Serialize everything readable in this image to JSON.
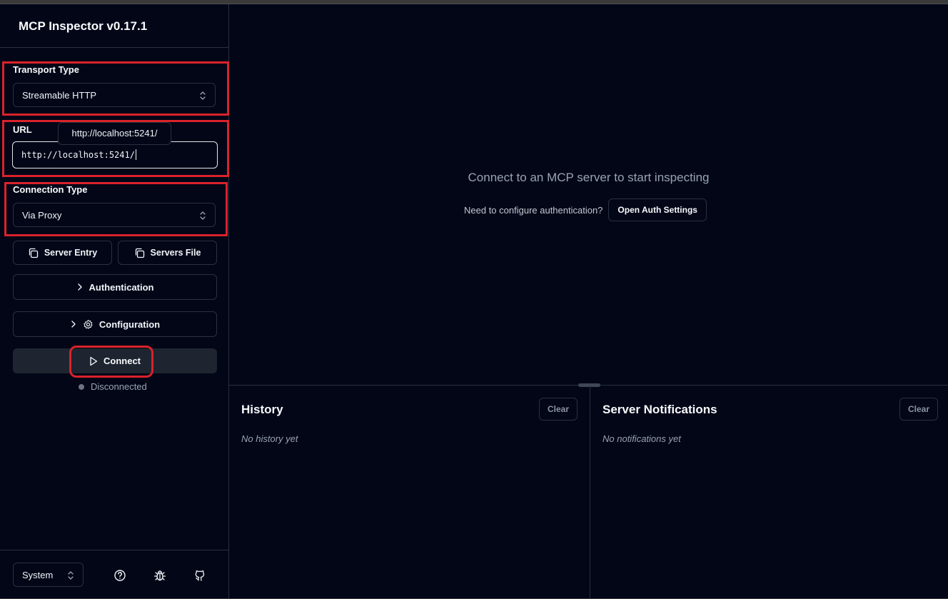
{
  "app": {
    "title": "MCP Inspector v0.17.1"
  },
  "sidebar": {
    "transport": {
      "label": "Transport Type",
      "value": "Streamable HTTP"
    },
    "url": {
      "label": "URL",
      "value": "http://localhost:5241/",
      "tooltip": "http://localhost:5241/"
    },
    "connection": {
      "label": "Connection Type",
      "value": "Via Proxy"
    },
    "server_entry_label": "Server Entry",
    "servers_file_label": "Servers File",
    "authentication_label": "Authentication",
    "configuration_label": "Configuration",
    "connect_label": "Connect",
    "status": "Disconnected",
    "footer": {
      "theme_value": "System",
      "icons": [
        "help-icon",
        "bug-icon",
        "github-icon"
      ]
    }
  },
  "main": {
    "empty_title": "Connect to an MCP server to start inspecting",
    "auth_hint": "Need to configure authentication?",
    "auth_button": "Open Auth Settings"
  },
  "history": {
    "title": "History",
    "clear_label": "Clear",
    "empty": "No history yet"
  },
  "notifications": {
    "title": "Server Notifications",
    "clear_label": "Clear",
    "empty": "No notifications yet"
  },
  "colors": {
    "background": "#020617",
    "border": "#2a3140",
    "highlight": "#d9222a",
    "muted_text": "#9aa3b2"
  }
}
